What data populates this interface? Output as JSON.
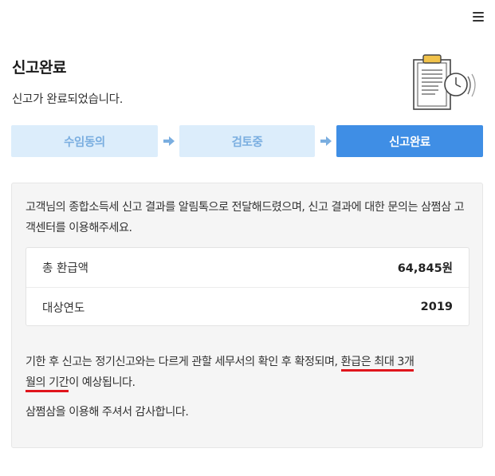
{
  "header": {
    "title": "신고완료",
    "subtitle": "신고가 완료되었습니다."
  },
  "steps": [
    {
      "label": "수임동의",
      "state": "inactive"
    },
    {
      "label": "검토중",
      "state": "inactive"
    },
    {
      "label": "신고완료",
      "state": "active"
    }
  ],
  "info": {
    "message": "고객님의 종합소득세 신고 결과를 알림톡으로 전달해드렸으며, 신고 결과에 대한 문의는 삼쩜삼 고객센터를 이용해주세요."
  },
  "summary": {
    "rows": [
      {
        "label": "총 환급액",
        "value": "64,845원"
      },
      {
        "label": "대상연도",
        "value": "2019"
      }
    ]
  },
  "notice": {
    "text_before": "기한 후 신고는 정기신고와는 다르게 관할 세무서의 확인 후 확정되며, ",
    "highlight_1": "환급은 최대 3개",
    "highlight_2": "월의 기간",
    "text_after": "이 예상됩니다."
  },
  "thanks": "삼쩜삼을 이용해 주셔서 감사합니다.",
  "colors": {
    "accent": "#3f8ee5",
    "step_inactive_bg": "#dcedfb",
    "step_inactive_text": "#7aaee0",
    "highlight_underline": "#e0151c",
    "arrow": "#7aaee0"
  }
}
